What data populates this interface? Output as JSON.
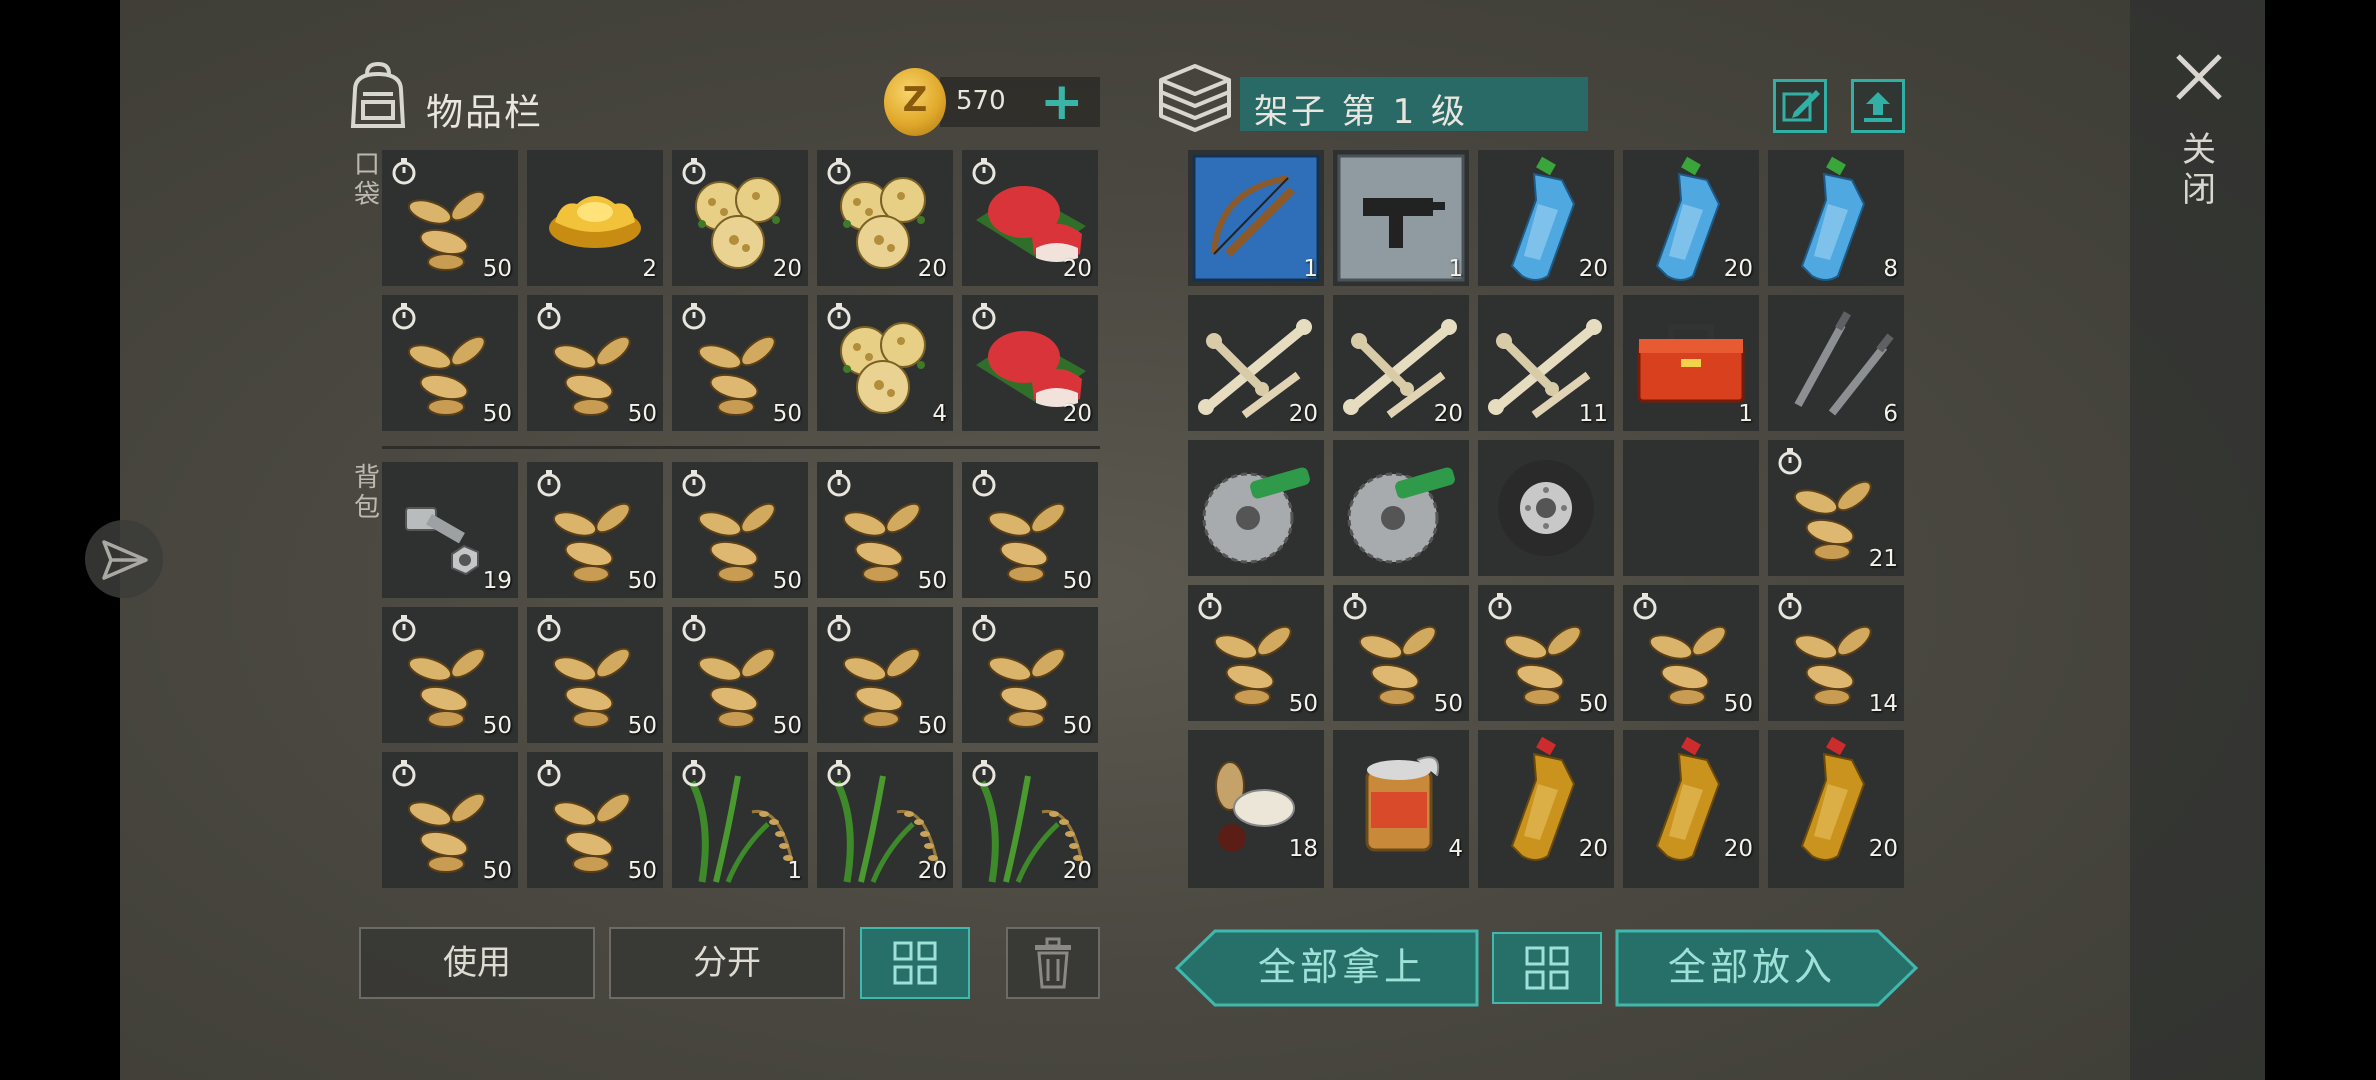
{
  "inventory": {
    "title": "物品栏",
    "coins": "570",
    "pocket_label": "口袋",
    "backpack_label": "背包",
    "pocket": [
      {
        "item": "seeds",
        "qty": "50",
        "timer": true
      },
      {
        "item": "gold-ingot",
        "qty": "2",
        "timer": false
      },
      {
        "item": "lotus-root",
        "qty": "20",
        "timer": true
      },
      {
        "item": "lotus-root",
        "qty": "20",
        "timer": true
      },
      {
        "item": "red-dumplings",
        "qty": "20",
        "timer": true
      },
      {
        "item": "seeds",
        "qty": "50",
        "timer": true
      },
      {
        "item": "seeds",
        "qty": "50",
        "timer": true
      },
      {
        "item": "seeds",
        "qty": "50",
        "timer": true
      },
      {
        "item": "lotus-root",
        "qty": "4",
        "timer": true
      },
      {
        "item": "red-dumplings",
        "qty": "20",
        "timer": true
      }
    ],
    "backpack": [
      {
        "item": "bolt-nut",
        "qty": "19",
        "timer": false
      },
      {
        "item": "seeds",
        "qty": "50",
        "timer": true
      },
      {
        "item": "seeds",
        "qty": "50",
        "timer": true
      },
      {
        "item": "seeds",
        "qty": "50",
        "timer": true
      },
      {
        "item": "seeds",
        "qty": "50",
        "timer": true
      },
      {
        "item": "seeds",
        "qty": "50",
        "timer": true
      },
      {
        "item": "seeds",
        "qty": "50",
        "timer": true
      },
      {
        "item": "seeds",
        "qty": "50",
        "timer": true
      },
      {
        "item": "seeds",
        "qty": "50",
        "timer": true
      },
      {
        "item": "seeds",
        "qty": "50",
        "timer": true
      },
      {
        "item": "seeds",
        "qty": "50",
        "timer": true
      },
      {
        "item": "seeds",
        "qty": "50",
        "timer": true
      },
      {
        "item": "rice-plant",
        "qty": "1",
        "timer": true
      },
      {
        "item": "rice-plant",
        "qty": "20",
        "timer": true
      },
      {
        "item": "rice-plant",
        "qty": "20",
        "timer": true
      }
    ],
    "buttons": {
      "use": "使用",
      "split": "分开"
    }
  },
  "shelf": {
    "title": "架子 第 1 级",
    "slots": [
      {
        "item": "crossbow-blueprint",
        "qty": "1",
        "timer": false
      },
      {
        "item": "uzi-blueprint",
        "qty": "1",
        "timer": false
      },
      {
        "item": "water-bottle",
        "qty": "20",
        "timer": false
      },
      {
        "item": "water-bottle",
        "qty": "20",
        "timer": false
      },
      {
        "item": "water-bottle",
        "qty": "8",
        "timer": false
      },
      {
        "item": "bones",
        "qty": "20",
        "timer": false
      },
      {
        "item": "bones",
        "qty": "20",
        "timer": false
      },
      {
        "item": "bones",
        "qty": "11",
        "timer": false
      },
      {
        "item": "toolbox",
        "qty": "1",
        "timer": false
      },
      {
        "item": "screws",
        "qty": "6",
        "timer": false
      },
      {
        "item": "saw-blade",
        "qty": "",
        "timer": false
      },
      {
        "item": "saw-blade",
        "qty": "",
        "timer": false
      },
      {
        "item": "tire",
        "qty": "",
        "timer": false
      },
      {
        "item": "empty",
        "qty": "",
        "timer": false
      },
      {
        "item": "seeds",
        "qty": "21",
        "timer": true
      },
      {
        "item": "seeds",
        "qty": "50",
        "timer": true
      },
      {
        "item": "seeds",
        "qty": "50",
        "timer": true
      },
      {
        "item": "seeds",
        "qty": "50",
        "timer": true
      },
      {
        "item": "seeds",
        "qty": "50",
        "timer": true
      },
      {
        "item": "seeds",
        "qty": "14",
        "timer": true
      },
      {
        "item": "nuts-mix",
        "qty": "18",
        "timer": false
      },
      {
        "item": "tin-can",
        "qty": "4",
        "timer": false
      },
      {
        "item": "oil-bottle",
        "qty": "20",
        "timer": false
      },
      {
        "item": "oil-bottle",
        "qty": "20",
        "timer": false
      },
      {
        "item": "oil-bottle",
        "qty": "20",
        "timer": false
      }
    ],
    "buttons": {
      "take_all": "全部拿上",
      "put_all": "全部放入"
    }
  },
  "close_label": "关闭"
}
